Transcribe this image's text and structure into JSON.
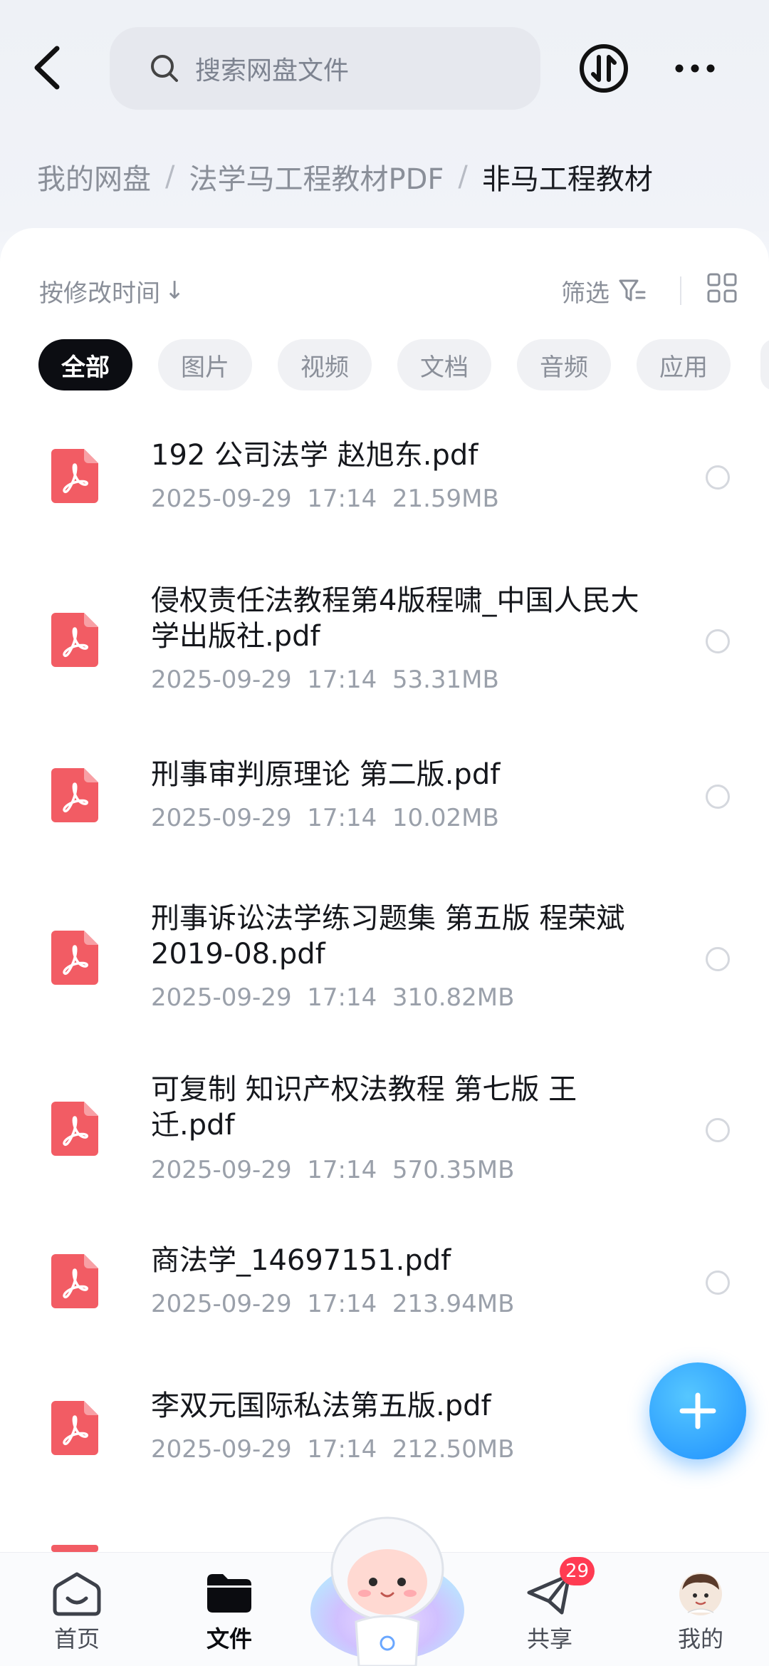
{
  "search": {
    "placeholder": "搜索网盘文件"
  },
  "breadcrumb": {
    "root": "我的网盘",
    "parent": "法学马工程教材PDF",
    "current": "非马工程教材",
    "separator": "/"
  },
  "toolbar": {
    "sort_label": "按修改时间",
    "sort_arrow": "↓",
    "filter_label": "筛选"
  },
  "chips": [
    {
      "label": "全部",
      "active": true
    },
    {
      "label": "图片"
    },
    {
      "label": "视频"
    },
    {
      "label": "文档"
    },
    {
      "label": "音频"
    },
    {
      "label": "应用"
    }
  ],
  "files": [
    {
      "name": "192   公司法学 赵旭东.pdf",
      "date": "2025-09-29",
      "time": "17:14",
      "size": "21.59MB"
    },
    {
      "name": "侵权责任法教程第4版程啸_中国人民大学出版社.pdf",
      "date": "2025-09-29",
      "time": "17:14",
      "size": "53.31MB"
    },
    {
      "name": "刑事审判原理论  第二版.pdf",
      "date": "2025-09-29",
      "time": "17:14",
      "size": "10.02MB"
    },
    {
      "name": "刑事诉讼法学练习题集 第五版 程荣斌 2019-08.pdf",
      "date": "2025-09-29",
      "time": "17:14",
      "size": "310.82MB"
    },
    {
      "name": "可复制 知识产权法教程 第七版 王迁.pdf",
      "date": "2025-09-29",
      "time": "17:14",
      "size": "570.35MB"
    },
    {
      "name": "商法学_14697151.pdf",
      "date": "2025-09-29",
      "time": "17:14",
      "size": "213.94MB"
    },
    {
      "name": "李双元国际私法第五版.pdf",
      "date": "2025-09-29",
      "time": "17:14",
      "size": "212.50MB"
    }
  ],
  "nav": {
    "home": "首页",
    "files": "文件",
    "share": "共享",
    "share_badge": "29",
    "me": "我的"
  },
  "colors": {
    "pdf_red": "#f25c64",
    "fab_blue": "#1e90ff",
    "badge_red": "#ff3b52"
  }
}
